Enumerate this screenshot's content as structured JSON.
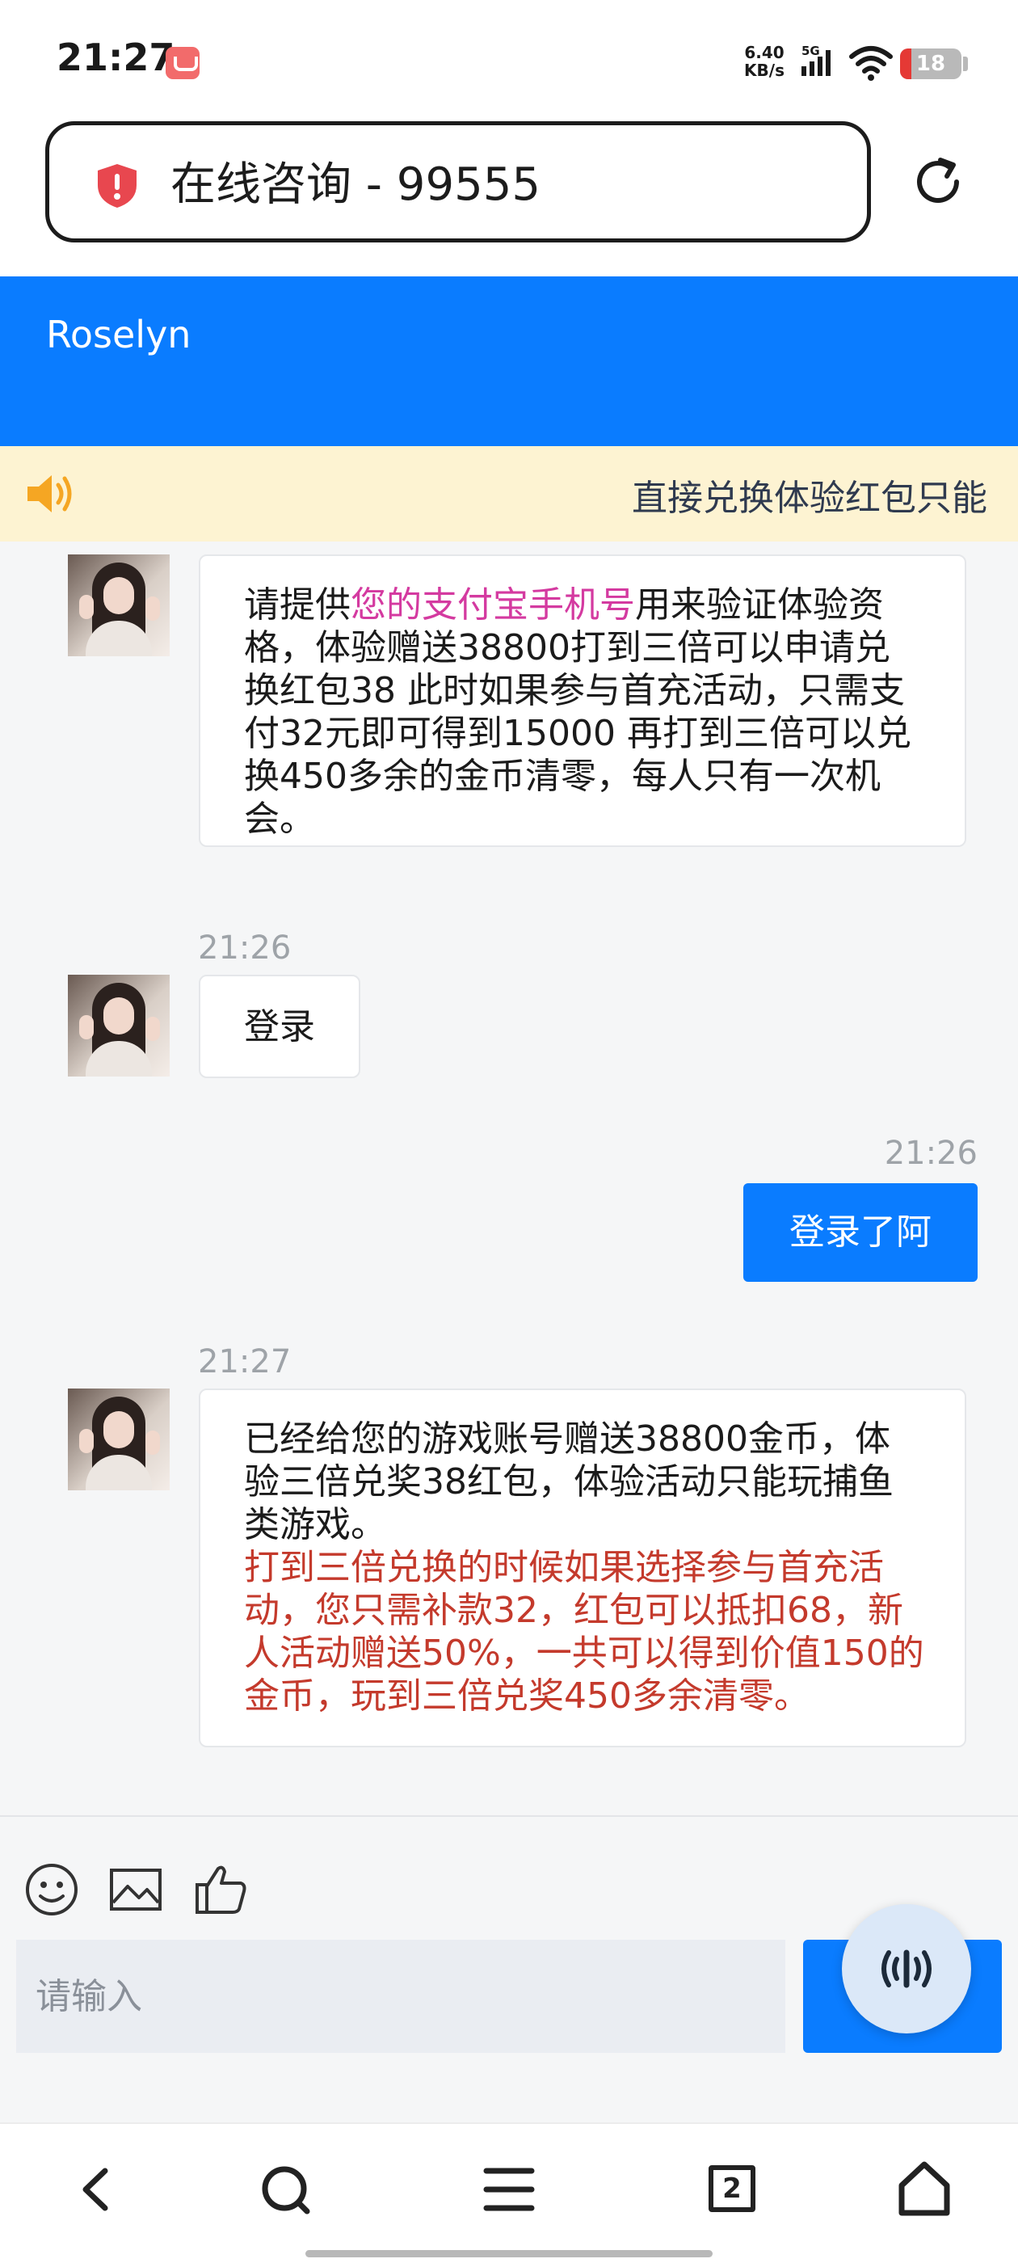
{
  "status_bar": {
    "time": "21:27",
    "network_speed_value": "6.40",
    "network_speed_unit": "KB/s",
    "network_type": "5G",
    "battery_level": "18",
    "battery_fraction": 0.18,
    "battery_color": "#e53935",
    "icons": [
      "shopping-bag-icon",
      "signal-icon",
      "wifi-icon",
      "battery-icon"
    ]
  },
  "browser": {
    "url_title": "在线咨询 - 99555",
    "icons": [
      "shield-icon",
      "reload-icon"
    ],
    "tab_count": "2",
    "nav_icons": [
      "back-icon",
      "search-icon",
      "menu-icon",
      "tabs-icon",
      "home-icon"
    ]
  },
  "chat": {
    "agent_name": "Roselyn",
    "notice": "直接兑换体验红包只能",
    "accent_color": "#0a7cff",
    "messages": [
      {
        "side": "left",
        "parts": [
          {
            "text": "请提供",
            "style": "normal"
          },
          {
            "text": "您的支付宝手机号",
            "style": "pink"
          },
          {
            "text": "用来验证体验资格，体验赠送38800打到三倍可以申请兑换红包38 此时如果参与首充活动，只需支付32元即可得到15000 再打到三倍可以兑换450多余的金币清零，每人只有一次机会。",
            "style": "normal"
          }
        ]
      },
      {
        "side": "left",
        "time": "21:26",
        "text": "登录"
      },
      {
        "side": "right",
        "time": "21:26",
        "text": "登录了阿"
      },
      {
        "side": "left",
        "time": "21:27",
        "parts": [
          {
            "text": "已经给您的游戏账号赠送38800金币，体验三倍兑奖38红包，体验活动只能玩捕鱼类游戏。",
            "style": "normal"
          },
          {
            "text": "打到三倍兑换的时候如果选择参与首充活动，您只需补款32，红包可以抵扣68，新人活动赠送50%，一共可以得到价值150的金币，玩到三倍兑奖450多余清零。",
            "style": "red"
          }
        ]
      }
    ]
  },
  "composer": {
    "placeholder": "请输入",
    "tool_icons": [
      "emoji-icon",
      "image-icon",
      "thumbs-up-icon"
    ],
    "voice_icon": "voice-wave-icon"
  }
}
